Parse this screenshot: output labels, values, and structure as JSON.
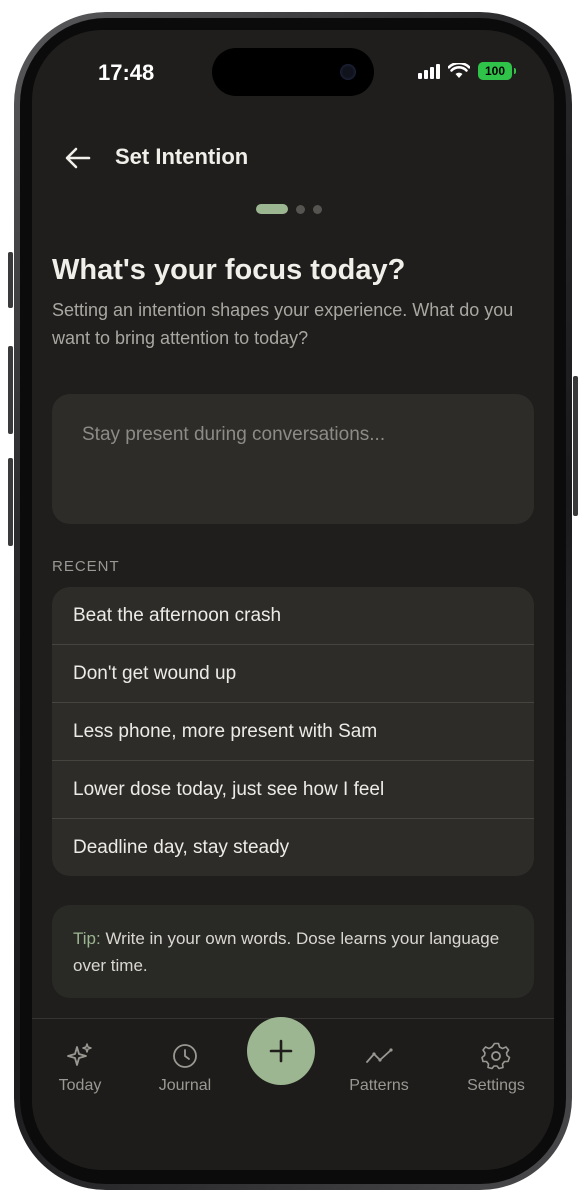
{
  "status_bar": {
    "time": "17:48",
    "battery": "100"
  },
  "header": {
    "title": "Set Intention"
  },
  "main": {
    "heading": "What's your focus today?",
    "subtitle": "Setting an intention shapes your experience. What do you want to bring attention to today?",
    "intention_placeholder": "Stay present during conversations..."
  },
  "recent": {
    "label": "RECENT",
    "items": [
      "Beat the afternoon crash",
      "Don't get wound up",
      "Less phone, more present with Sam",
      "Lower dose today, just see how I feel",
      "Deadline day, stay steady"
    ]
  },
  "tip": {
    "label": "Tip:",
    "text": " Write in your own words. Dose learns your language over time."
  },
  "tab_bar": {
    "tabs": [
      {
        "label": "Today",
        "icon": "sparkles-icon"
      },
      {
        "label": "Journal",
        "icon": "clock-icon"
      },
      {
        "label": "Patterns",
        "icon": "trend-icon"
      },
      {
        "label": "Settings",
        "icon": "gear-icon"
      }
    ],
    "add_icon": "plus-icon"
  },
  "colors": {
    "accent": "#9cb691",
    "background": "#1f1e1c",
    "card": "#2d2c29"
  }
}
